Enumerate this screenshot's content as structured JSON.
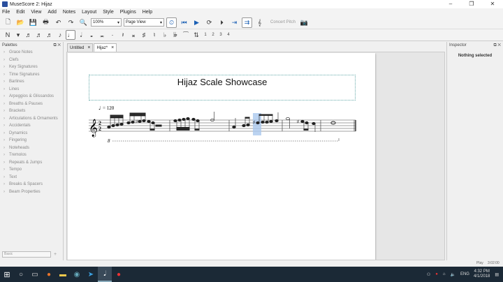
{
  "window": {
    "title": "MuseScore 2: Hijaz",
    "controls": [
      "–",
      "❐",
      "✕"
    ]
  },
  "menu": [
    "File",
    "Edit",
    "View",
    "Add",
    "Notes",
    "Layout",
    "Style",
    "Plugins",
    "Help"
  ],
  "toolbar": {
    "zoom": "100%",
    "view_mode": "Page View",
    "concert_pitch": "Concert Pitch"
  },
  "note_input": {
    "voices": [
      "1",
      "2",
      "3",
      "4"
    ]
  },
  "palettes": {
    "header": "Palettes",
    "items": [
      "Grace Notes",
      "Clefs",
      "Key Signatures",
      "Time Signatures",
      "Barlines",
      "Lines",
      "Arpeggios & Glissandos",
      "Breaths & Pauses",
      "Brackets",
      "Articulations & Ornaments",
      "Accidentals",
      "Dynamics",
      "Fingering",
      "Noteheads",
      "Tremolos",
      "Repeats & Jumps",
      "Tempo",
      "Text",
      "Breaks & Spacers",
      "Beam Properties"
    ],
    "workspace": "Basic"
  },
  "tabs": [
    {
      "label": "Untitled",
      "close": "×"
    },
    {
      "label": "Hijaz*",
      "close": "×"
    }
  ],
  "score": {
    "title": "Hijaz Scale Showcase",
    "tempo_equals": "= 120",
    "time_sig_top": "2",
    "time_sig_bottom": "2",
    "octave_mark": "8"
  },
  "inspector": {
    "header": "Inspector",
    "message": "Nothing selected"
  },
  "status": {
    "mode": "Play",
    "time": "3:02:00"
  },
  "taskbar": {
    "lang": "ENG",
    "time": "4:32 PM",
    "date": "4/1/2018"
  },
  "colors": {
    "accent": "#1a5fb4",
    "selection": "#aac8ee",
    "taskbar": "#1b2936"
  }
}
